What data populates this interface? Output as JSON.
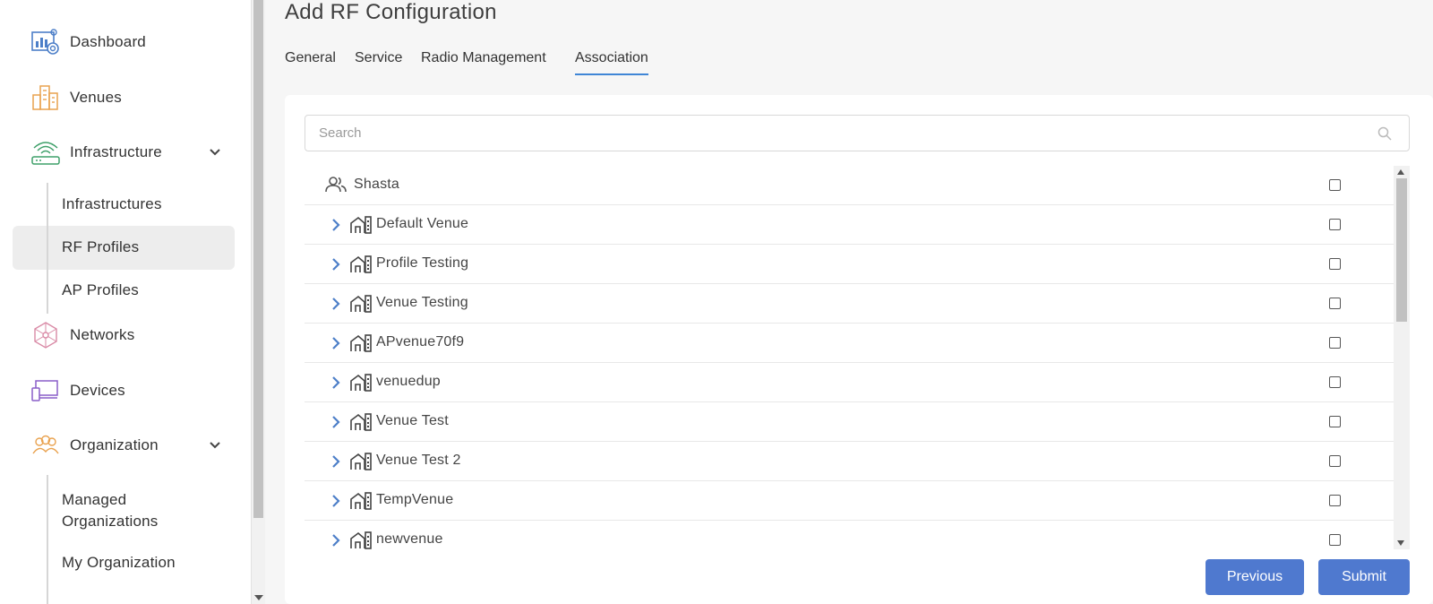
{
  "colors": {
    "accent": "#4f79cf",
    "tab_underline": "#3f86d6",
    "icon_blue": "#4d7fc8",
    "icon_orange": "#e9a24f",
    "icon_green": "#3fa06a",
    "icon_pink": "#d98aa6",
    "icon_purple": "#8a5fc8"
  },
  "sidebar": {
    "items": [
      {
        "label": "Dashboard",
        "icon": "dashboard-icon"
      },
      {
        "label": "Venues",
        "icon": "venues-icon"
      },
      {
        "label": "Infrastructure",
        "icon": "infrastructure-icon"
      },
      {
        "label": "Networks",
        "icon": "networks-icon"
      },
      {
        "label": "Devices",
        "icon": "devices-icon"
      },
      {
        "label": "Organization",
        "icon": "organization-icon"
      }
    ],
    "infrastructure_sub": [
      "Infrastructures",
      "RF Profiles",
      "AP Profiles"
    ],
    "organization_sub": [
      "Managed Organizations",
      "My Organization"
    ],
    "active": "RF Profiles"
  },
  "page": {
    "title": "Add RF Configuration"
  },
  "tabs": [
    {
      "label": "General"
    },
    {
      "label": "Service"
    },
    {
      "label": "Radio Management"
    },
    {
      "label": "Association"
    }
  ],
  "active_tab": "Association",
  "search": {
    "placeholder": "Search",
    "value": ""
  },
  "tree": {
    "root": {
      "label": "Shasta",
      "checked": false
    },
    "venues": [
      {
        "label": "Default Venue",
        "checked": false
      },
      {
        "label": "Profile Testing",
        "checked": false
      },
      {
        "label": "Venue Testing",
        "checked": false
      },
      {
        "label": "APvenue70f9",
        "checked": false
      },
      {
        "label": "venuedup",
        "checked": false
      },
      {
        "label": "Venue Test",
        "checked": false
      },
      {
        "label": "Venue Test 2",
        "checked": false
      },
      {
        "label": "TempVenue",
        "checked": false
      },
      {
        "label": "newvenue",
        "checked": false
      }
    ]
  },
  "buttons": {
    "previous": "Previous",
    "submit": "Submit"
  }
}
